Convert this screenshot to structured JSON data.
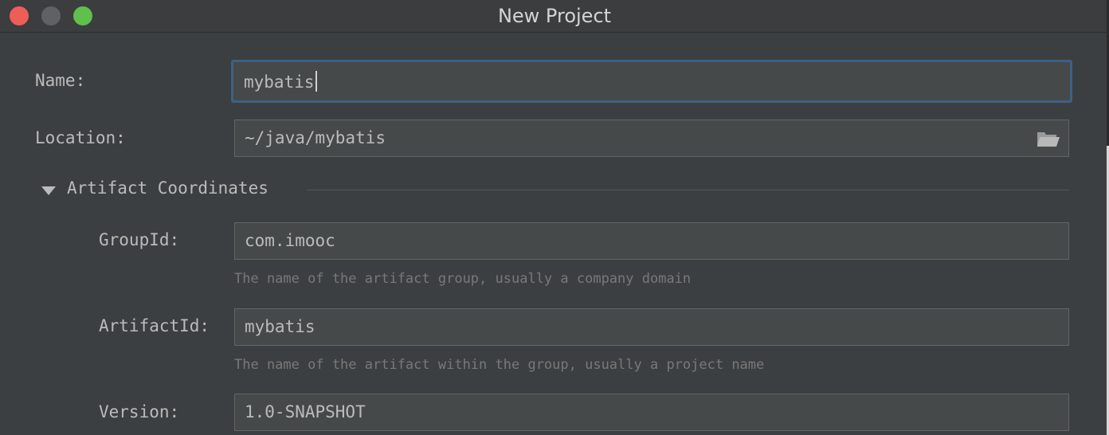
{
  "window": {
    "title": "New Project"
  },
  "form": {
    "name": {
      "label": "Name:",
      "value": "mybatis"
    },
    "location": {
      "label": "Location:",
      "value": "~/java/mybatis",
      "icon": "folder-open-icon"
    },
    "artifact_coordinates": {
      "title": "Artifact Coordinates",
      "group_id": {
        "label": "GroupId:",
        "value": "com.imooc",
        "hint": "The name of the artifact group, usually a company domain"
      },
      "artifact_id": {
        "label": "ArtifactId:",
        "value": "mybatis",
        "hint": "The name of the artifact within the group, usually a project name"
      },
      "version": {
        "label": "Version:",
        "value": "1.0-SNAPSHOT"
      }
    }
  },
  "colors": {
    "background": "#3c3f41",
    "field_background": "#45494a",
    "focus_border": "#3d6185",
    "text": "#bbbbbb",
    "hint_text": "#787878",
    "close": "#ee5e57",
    "minimize": "#5f6164",
    "maximize": "#5fc04b"
  }
}
